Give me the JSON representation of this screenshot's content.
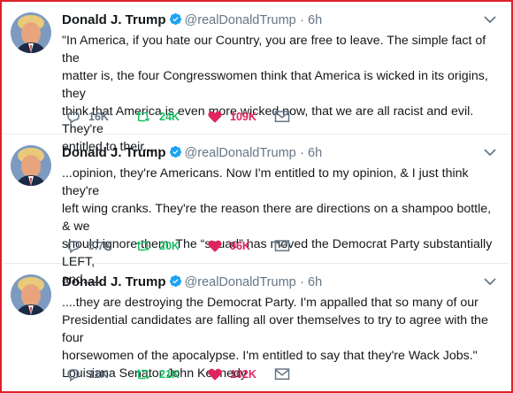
{
  "colors": {
    "frame": "#e0202a",
    "verified": "#1da1f2",
    "retweet": "#17bf63",
    "like": "#e0245e",
    "muted": "#657786"
  },
  "tweets": [
    {
      "name": "Donald J. Trump",
      "handle": "@realDonaldTrump",
      "time": "· 6h",
      "text": "\"In America, if you hate our Country, you are free to leave. The simple fact of the\nmatter is, the four Congresswomen think that America is wicked in its origins, they\nthink that America is even more wicked now, that we are all racist and evil. They're\nentitled to their.....",
      "replies": "16K",
      "retweets": "24K",
      "likes": "109K"
    },
    {
      "name": "Donald J. Trump",
      "handle": "@realDonaldTrump",
      "time": "· 6h",
      "text": "...opinion, they're Americans. Now I'm entitled to my opinion, & I just think they're\nleft wing cranks. They're the reason there are directions on a shampoo bottle, & we\nshould ignore them. The “squad” has moved the Democrat Party substantially LEFT,\nand.....",
      "replies": "5.7K",
      "retweets": "20K",
      "likes": "96K"
    },
    {
      "name": "Donald J. Trump",
      "handle": "@realDonaldTrump",
      "time": "· 6h",
      "text": "....they are destroying the Democrat Party. I'm appalled that so many of our\nPresidential candidates are falling all over themselves to try to agree with the four\nhorsewomen of the apocalypse. I'm entitled to say that they're Wack Jobs.\"\nLouisiana Senator John Kennedy",
      "replies": "11K",
      "retweets": "21K",
      "likes": "102K"
    }
  ]
}
